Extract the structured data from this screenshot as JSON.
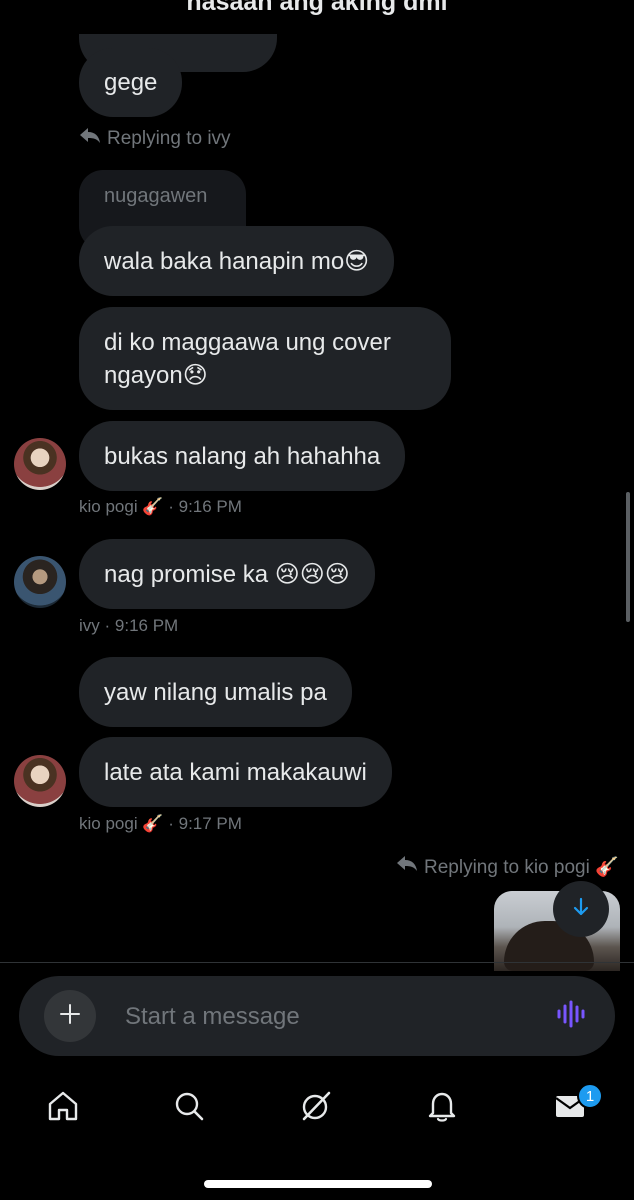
{
  "header": {
    "title": "nasaan ang aking dml"
  },
  "messages": {
    "m1": {
      "text": "gege"
    },
    "reply1": {
      "text": "Replying to ivy"
    },
    "quoted1": {
      "text": "nugagawen"
    },
    "m2": {
      "text": "wala baka hanapin mo",
      "emoji": "😎"
    },
    "m3": {
      "text": "di ko maggaawa ung cover ngayon",
      "emoji": "😞"
    },
    "m4": {
      "text": "bukas nalang ah hahahha",
      "sender": "kio pogi 🎸",
      "time": "· 9:16 PM"
    },
    "m5": {
      "text": "nag promise ka",
      "emoji": "😢😢😢",
      "sender": "ivy",
      "time": "· 9:16 PM"
    },
    "m6": {
      "text": "yaw nilang umalis pa"
    },
    "m7": {
      "text": "late ata kami makakauwi",
      "sender": "kio pogi 🎸",
      "time": "· 9:17 PM"
    },
    "reply2": {
      "text": "Replying to kio pogi 🎸"
    }
  },
  "composer": {
    "placeholder": "Start a message"
  },
  "tabs": [
    "home",
    "search",
    "grok",
    "notifications",
    "messages"
  ],
  "badge": {
    "count": "1"
  },
  "colors": {
    "background": "#000000",
    "bubble": "#202327",
    "accent": "#1d9bf0",
    "muted": "#71767b",
    "voice": "#7856ff"
  }
}
